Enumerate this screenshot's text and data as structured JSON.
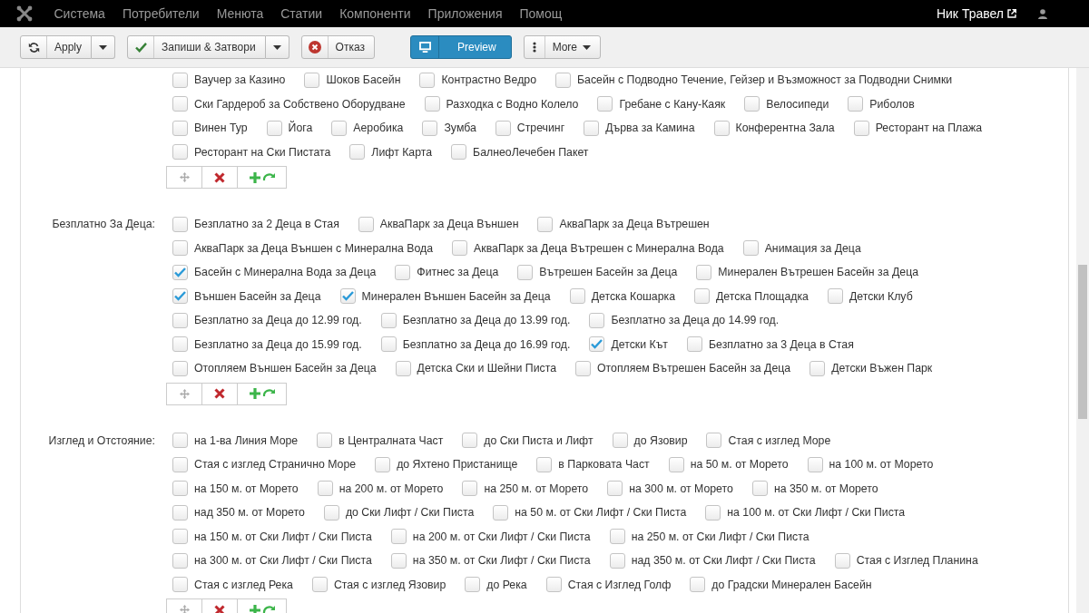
{
  "menu": {
    "items": [
      "Система",
      "Потребители",
      "Менюта",
      "Статии",
      "Компоненти",
      "Приложения",
      "Помощ"
    ]
  },
  "user": {
    "name": "Ник Травел"
  },
  "toolbar": {
    "buttons": [
      {
        "kind": "apply",
        "label": "Apply",
        "dropdown": true
      },
      {
        "kind": "save",
        "label": "Запиши & Затвори",
        "dropdown": true
      },
      {
        "kind": "cancel",
        "label": "Отказ",
        "dropdown": false
      },
      {
        "kind": "preview",
        "label": "Preview",
        "dropdown": false
      },
      {
        "kind": "more",
        "label": "More",
        "dropdown": false
      }
    ]
  },
  "sections": [
    {
      "options": [
        {
          "label": "Ваучер за Казино",
          "checked": false
        },
        {
          "label": "Шоков Басейн",
          "checked": false
        },
        {
          "label": "Контрастно Ведро",
          "checked": false
        },
        {
          "label": "Басейн с Подводно Течение, Гейзер и Възможност за Подводни Снимки",
          "checked": false
        },
        {
          "label": "Ски Гардероб за Собствено Оборудване",
          "checked": false
        },
        {
          "label": "Разходка с Водно Колело",
          "checked": false
        },
        {
          "label": "Гребане с Кану-Каяк",
          "checked": false
        },
        {
          "label": "Велосипеди",
          "checked": false
        },
        {
          "label": "Риболов",
          "checked": false
        },
        {
          "label": "Винен Тур",
          "checked": false
        },
        {
          "label": "Йога",
          "checked": false
        },
        {
          "label": "Аеробика",
          "checked": false
        },
        {
          "label": "Зумба",
          "checked": false
        },
        {
          "label": "Стречинг",
          "checked": false
        },
        {
          "label": "Дърва за Камина",
          "checked": false
        },
        {
          "label": "Конферентна Зала",
          "checked": false
        },
        {
          "label": "Ресторант на Плажа",
          "checked": false
        },
        {
          "label": "Ресторант на Ски Пистата",
          "checked": false
        },
        {
          "label": "Лифт Карта",
          "checked": false
        },
        {
          "label": "БалнеоЛечебен Пакет",
          "checked": false
        }
      ]
    },
    {
      "label": "Безплатно За Деца:",
      "options": [
        {
          "label": "Безплатно за 2 Деца в Стая",
          "checked": false
        },
        {
          "label": "АкваПарк за Деца Външен",
          "checked": false
        },
        {
          "label": "АкваПарк за Деца Вътрешен",
          "checked": false
        },
        {
          "label": "АкваПарк за Деца Външен с Минерална Вода",
          "checked": false
        },
        {
          "label": "АкваПарк за Деца Вътрешен с Минерална Вода",
          "checked": false
        },
        {
          "label": "Анимация за Деца",
          "checked": false
        },
        {
          "label": "Басейн с Минерална Вода за Деца",
          "checked": true
        },
        {
          "label": "Фитнес за Деца",
          "checked": false
        },
        {
          "label": "Вътрешен Басейн за Деца",
          "checked": false
        },
        {
          "label": "Минерален Вътрешен Басейн за Деца",
          "checked": false
        },
        {
          "label": "Външен Басейн за Деца",
          "checked": true
        },
        {
          "label": "Минерален Външен Басейн за Деца",
          "checked": true
        },
        {
          "label": "Детска Кошарка",
          "checked": false
        },
        {
          "label": "Детска Площадка",
          "checked": false
        },
        {
          "label": "Детски Клуб",
          "checked": false
        },
        {
          "label": "Безплатно за Деца до 12.99 год.",
          "checked": false
        },
        {
          "label": "Безплатно за Деца до 13.99 год.",
          "checked": false
        },
        {
          "label": "Безплатно за Деца до 14.99 год.",
          "checked": false
        },
        {
          "label": "Безплатно за Деца до 15.99 год.",
          "checked": false
        },
        {
          "label": "Безплатно за Деца до 16.99 год.",
          "checked": false
        },
        {
          "label": "Детски Кът",
          "checked": true
        },
        {
          "label": "Безплатно за 3 Деца в Стая",
          "checked": false
        },
        {
          "label": "Отопляем Външен Басейн за Деца",
          "checked": false
        },
        {
          "label": "Детска Ски и Шейни Писта",
          "checked": false
        },
        {
          "label": "Отопляем Вътрешен Басейн за Деца",
          "checked": false
        },
        {
          "label": "Детски Въжен Парк",
          "checked": false
        }
      ]
    },
    {
      "label": "Изглед и Отстояние:",
      "options": [
        {
          "label": "на 1-ва Линия Море",
          "checked": false
        },
        {
          "label": "в Централната Част",
          "checked": false
        },
        {
          "label": "до Ски Писта и Лифт",
          "checked": false
        },
        {
          "label": "до Язовир",
          "checked": false
        },
        {
          "label": "Стая с изглед Море",
          "checked": false
        },
        {
          "label": "Стая с изглед Странично Море",
          "checked": false
        },
        {
          "label": "до Яхтено Пристанище",
          "checked": false
        },
        {
          "label": "в Парковата Част",
          "checked": false
        },
        {
          "label": "на 50 м. от Морето",
          "checked": false
        },
        {
          "label": "на 100 м. от Морето",
          "checked": false
        },
        {
          "label": "на 150 м. от Морето",
          "checked": false
        },
        {
          "label": "на 200 м. от Морето",
          "checked": false
        },
        {
          "label": "на 250 м. от Морето",
          "checked": false
        },
        {
          "label": "на 300 м. от Морето",
          "checked": false
        },
        {
          "label": "на 350 м. от Морето",
          "checked": false
        },
        {
          "label": "над 350 м. от Морето",
          "checked": false
        },
        {
          "label": "до Ски Лифт / Ски Писта",
          "checked": false
        },
        {
          "label": "на 50 м. от Ски Лифт / Ски Писта",
          "checked": false
        },
        {
          "label": "на 100 м. от Ски Лифт / Ски Писта",
          "checked": false
        },
        {
          "label": "на 150 м. от Ски Лифт / Ски Писта",
          "checked": false
        },
        {
          "label": "на 200 м. от Ски Лифт / Ски Писта",
          "checked": false
        },
        {
          "label": "на 250 м. от Ски Лифт / Ски Писта",
          "checked": false
        },
        {
          "label": "на 300 м. от Ски Лифт / Ски Писта",
          "checked": false
        },
        {
          "label": "на 350 м. от Ски Лифт / Ски Писта",
          "checked": false
        },
        {
          "label": "над 350 м. от Ски Лифт / Ски Писта",
          "checked": false
        },
        {
          "label": "Стая с Изглед Планина",
          "checked": false
        },
        {
          "label": "Стая с изглед Река",
          "checked": false
        },
        {
          "label": "Стая с изглед Язовир",
          "checked": false
        },
        {
          "label": "до Река",
          "checked": false
        },
        {
          "label": "Стая с Изглед Голф",
          "checked": false
        },
        {
          "label": "до Градски Минерален Басейн",
          "checked": false
        }
      ]
    }
  ]
}
